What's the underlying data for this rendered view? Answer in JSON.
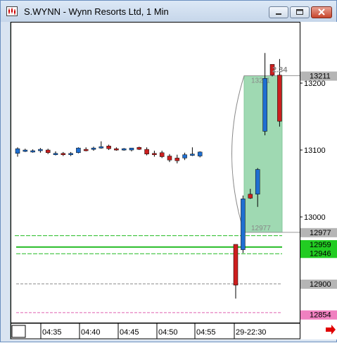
{
  "window": {
    "title": "S.WYNN - Wynn Resorts Ltd, 1 Min"
  },
  "chart_data": {
    "type": "candlestick",
    "symbol": "S.WYNN",
    "interval": "1 Min",
    "y_ticks": [
      "13200",
      "13100",
      "13000"
    ],
    "price_tags": [
      {
        "label": "13211",
        "value": 132.11,
        "color": "#b5b5b5"
      },
      {
        "label": "12977",
        "value": 129.77,
        "color": "#b5b5b5"
      },
      {
        "label": "12959",
        "value": 129.59,
        "color": "#22cc22"
      },
      {
        "label": "12946",
        "value": 129.46,
        "color": "#22cc22"
      },
      {
        "label": "12900",
        "value": 129.0,
        "color": "#b5b5b5"
      },
      {
        "label": "12854",
        "value": 128.54,
        "color": "#f080c0"
      }
    ],
    "x_ticks": [
      "04:35",
      "04:40",
      "04:45",
      "04:50",
      "04:55",
      "29-22:30"
    ],
    "measure_box": {
      "top_label": "13211",
      "bottom_label": "12977",
      "change_label": "2.34"
    },
    "candles": [
      {
        "o": 130.95,
        "h": 131.04,
        "l": 130.9,
        "c": 131.02
      },
      {
        "o": 130.99,
        "h": 131.02,
        "l": 130.97,
        "c": 131.0
      },
      {
        "o": 130.98,
        "h": 131.01,
        "l": 130.96,
        "c": 130.99
      },
      {
        "o": 130.99,
        "h": 131.03,
        "l": 130.96,
        "c": 131.01
      },
      {
        "o": 131.0,
        "h": 131.02,
        "l": 130.94,
        "c": 130.96
      },
      {
        "o": 130.94,
        "h": 130.98,
        "l": 130.92,
        "c": 130.95
      },
      {
        "o": 130.95,
        "h": 130.97,
        "l": 130.91,
        "c": 130.93
      },
      {
        "o": 130.94,
        "h": 130.97,
        "l": 130.91,
        "c": 130.95
      },
      {
        "o": 130.96,
        "h": 131.04,
        "l": 130.95,
        "c": 131.03
      },
      {
        "o": 131.01,
        "h": 131.04,
        "l": 130.98,
        "c": 131.0
      },
      {
        "o": 131.01,
        "h": 131.05,
        "l": 130.99,
        "c": 131.03
      },
      {
        "o": 131.03,
        "h": 131.13,
        "l": 131.02,
        "c": 131.05
      },
      {
        "o": 131.06,
        "h": 131.08,
        "l": 131.0,
        "c": 131.02
      },
      {
        "o": 131.02,
        "h": 131.04,
        "l": 130.99,
        "c": 131.0
      },
      {
        "o": 131.01,
        "h": 131.03,
        "l": 130.99,
        "c": 131.02
      },
      {
        "o": 131.0,
        "h": 131.03,
        "l": 130.98,
        "c": 131.03
      },
      {
        "o": 131.04,
        "h": 131.05,
        "l": 131.0,
        "c": 131.01
      },
      {
        "o": 131.01,
        "h": 131.04,
        "l": 130.92,
        "c": 130.94
      },
      {
        "o": 130.95,
        "h": 130.99,
        "l": 130.9,
        "c": 130.93
      },
      {
        "o": 130.96,
        "h": 130.99,
        "l": 130.88,
        "c": 130.9
      },
      {
        "o": 130.91,
        "h": 130.94,
        "l": 130.82,
        "c": 130.85
      },
      {
        "o": 130.88,
        "h": 130.93,
        "l": 130.8,
        "c": 130.84
      },
      {
        "o": 130.88,
        "h": 130.96,
        "l": 130.85,
        "c": 130.93
      },
      {
        "o": 130.94,
        "h": 131.04,
        "l": 130.91,
        "c": 130.94
      },
      {
        "o": 130.91,
        "h": 130.98,
        "l": 130.89,
        "c": 130.97
      },
      {
        "o": 129.59,
        "h": 129.59,
        "l": 128.78,
        "c": 128.98
      },
      {
        "o": 129.51,
        "h": 130.32,
        "l": 129.46,
        "c": 130.27
      },
      {
        "o": 130.34,
        "h": 130.42,
        "l": 130.27,
        "c": 130.28
      },
      {
        "o": 130.34,
        "h": 130.73,
        "l": 130.15,
        "c": 130.71
      },
      {
        "o": 131.28,
        "h": 132.45,
        "l": 131.22,
        "c": 132.07
      },
      {
        "o": 132.28,
        "h": 132.23,
        "l": 132.1,
        "c": 132.12
      },
      {
        "o": 132.12,
        "h": 132.36,
        "l": 131.35,
        "c": 131.43
      }
    ]
  }
}
